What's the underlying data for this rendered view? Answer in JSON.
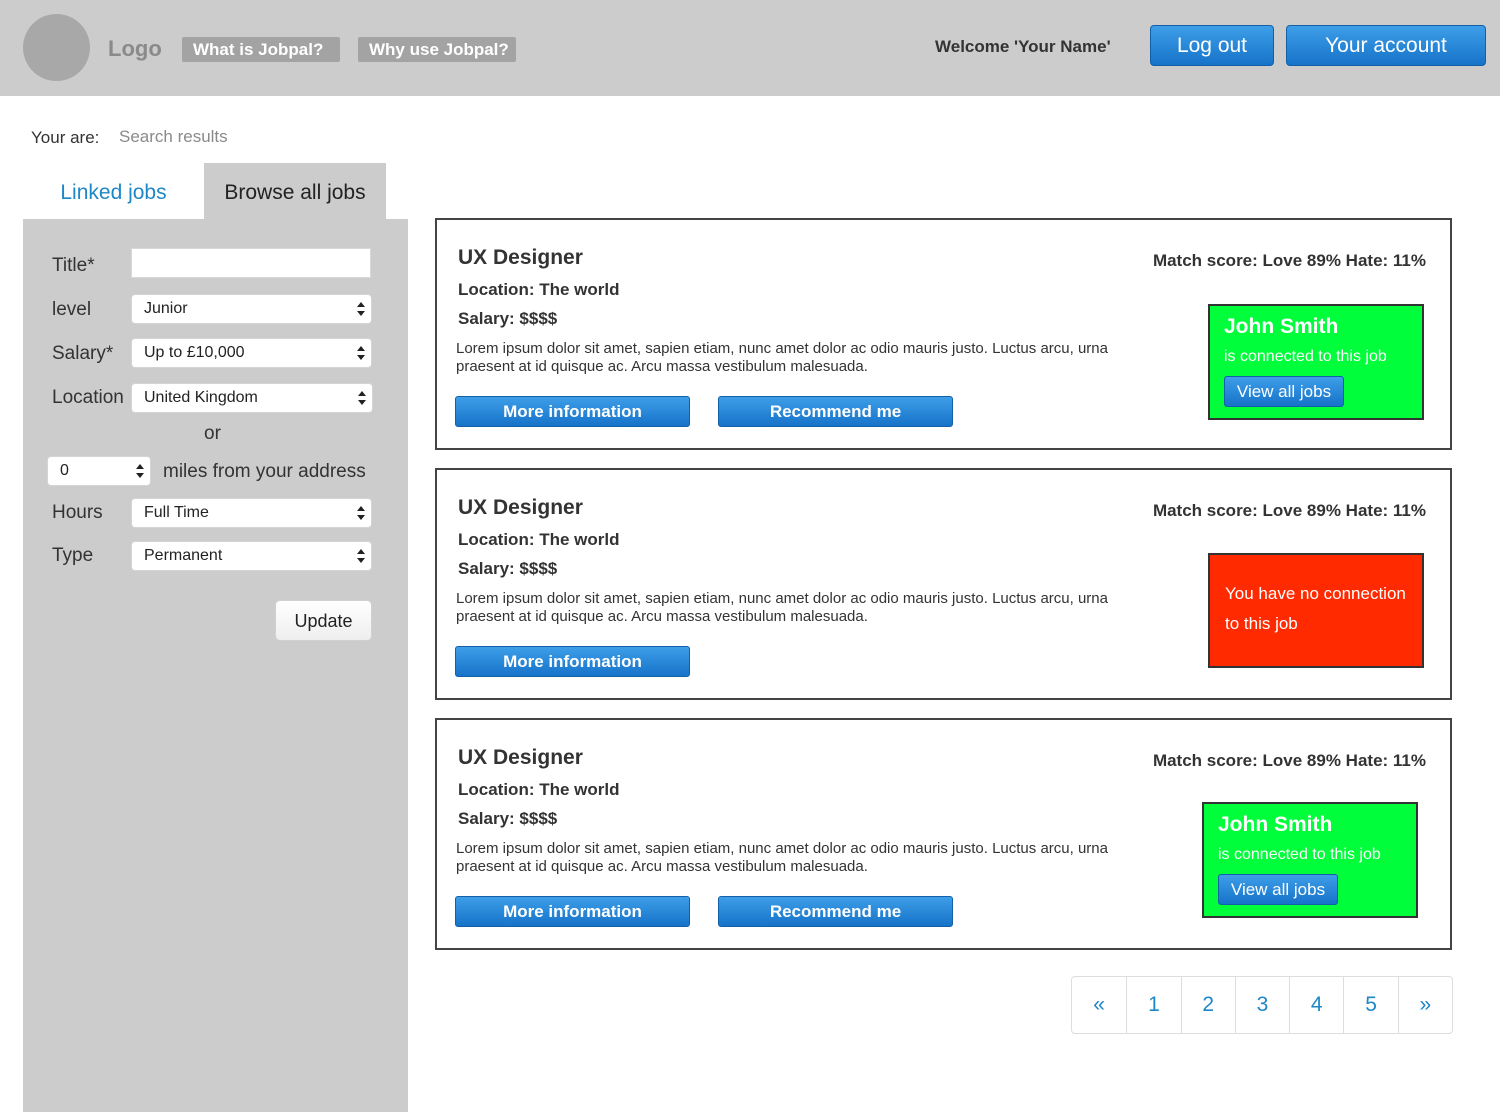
{
  "header": {
    "logo": "Logo",
    "nav": [
      "What is Jobpal?",
      "Why use Jobpal?"
    ],
    "welcome": "Welcome 'Your Name'",
    "logout": "Log out",
    "account": "Your account"
  },
  "breadcrumb": {
    "label": "Your are:",
    "value": "Search results"
  },
  "tabs": {
    "linked": "Linked jobs",
    "browse": "Browse all jobs"
  },
  "filters": {
    "title_label": "Title*",
    "title_value": "",
    "level_label": "level",
    "level_value": "Junior",
    "salary_label": "Salary*",
    "salary_value": "Up to £10,000",
    "location_label": "Location",
    "location_value": "United Kingdom",
    "or": "or",
    "miles_value": "0",
    "miles_label": "miles from your address",
    "hours_label": "Hours",
    "hours_value": "Full Time",
    "type_label": "Type",
    "type_value": "Permanent",
    "update": "Update"
  },
  "jobs": [
    {
      "title": "UX Designer",
      "location": "Location: The world",
      "salary": "Salary: $$$$",
      "description": "Lorem ipsum dolor sit amet, sapien etiam, nunc amet dolor ac odio mauris justo. Luctus arcu, urna praesent at id quisque ac. Arcu massa vestibulum malesuada.",
      "match": "Match score: Love 89% Hate: 11%",
      "more": "More information",
      "recommend": "Recommend me",
      "connection": {
        "name": "John Smith",
        "text": "is connected to this job",
        "button": "View all jobs"
      }
    },
    {
      "title": "UX Designer",
      "location": "Location: The world",
      "salary": "Salary: $$$$",
      "description": "Lorem ipsum dolor sit amet, sapien etiam, nunc amet dolor ac odio mauris justo. Luctus arcu, urna praesent at id quisque ac. Arcu massa vestibulum malesuada.",
      "match": "Match score: Love 89% Hate: 11%",
      "more": "More information",
      "no_connection": "You have no connection to this job"
    },
    {
      "title": "UX Designer",
      "location": "Location: The world",
      "salary": "Salary: $$$$",
      "description": "Lorem ipsum dolor sit amet, sapien etiam, nunc amet dolor ac odio mauris justo. Luctus arcu, urna praesent at id quisque ac. Arcu massa vestibulum malesuada.",
      "match": "Match score: Love 89% Hate: 11%",
      "more": "More information",
      "recommend": "Recommend me",
      "connection": {
        "name": "John Smith",
        "text": "is connected to this job",
        "button": "View all jobs"
      }
    }
  ],
  "pagination": {
    "prev": "«",
    "pages": [
      "1",
      "2",
      "3",
      "4",
      "5"
    ],
    "next": "»"
  },
  "colors": {
    "header_bg": "#cccccc",
    "primary_blue": "#1673c9",
    "connected_green": "#00ff3a",
    "no_connection_red": "#ff2a00",
    "link_blue": "#1e87c8"
  },
  "icons": {
    "select_arrows": "up-down-arrows-icon"
  }
}
